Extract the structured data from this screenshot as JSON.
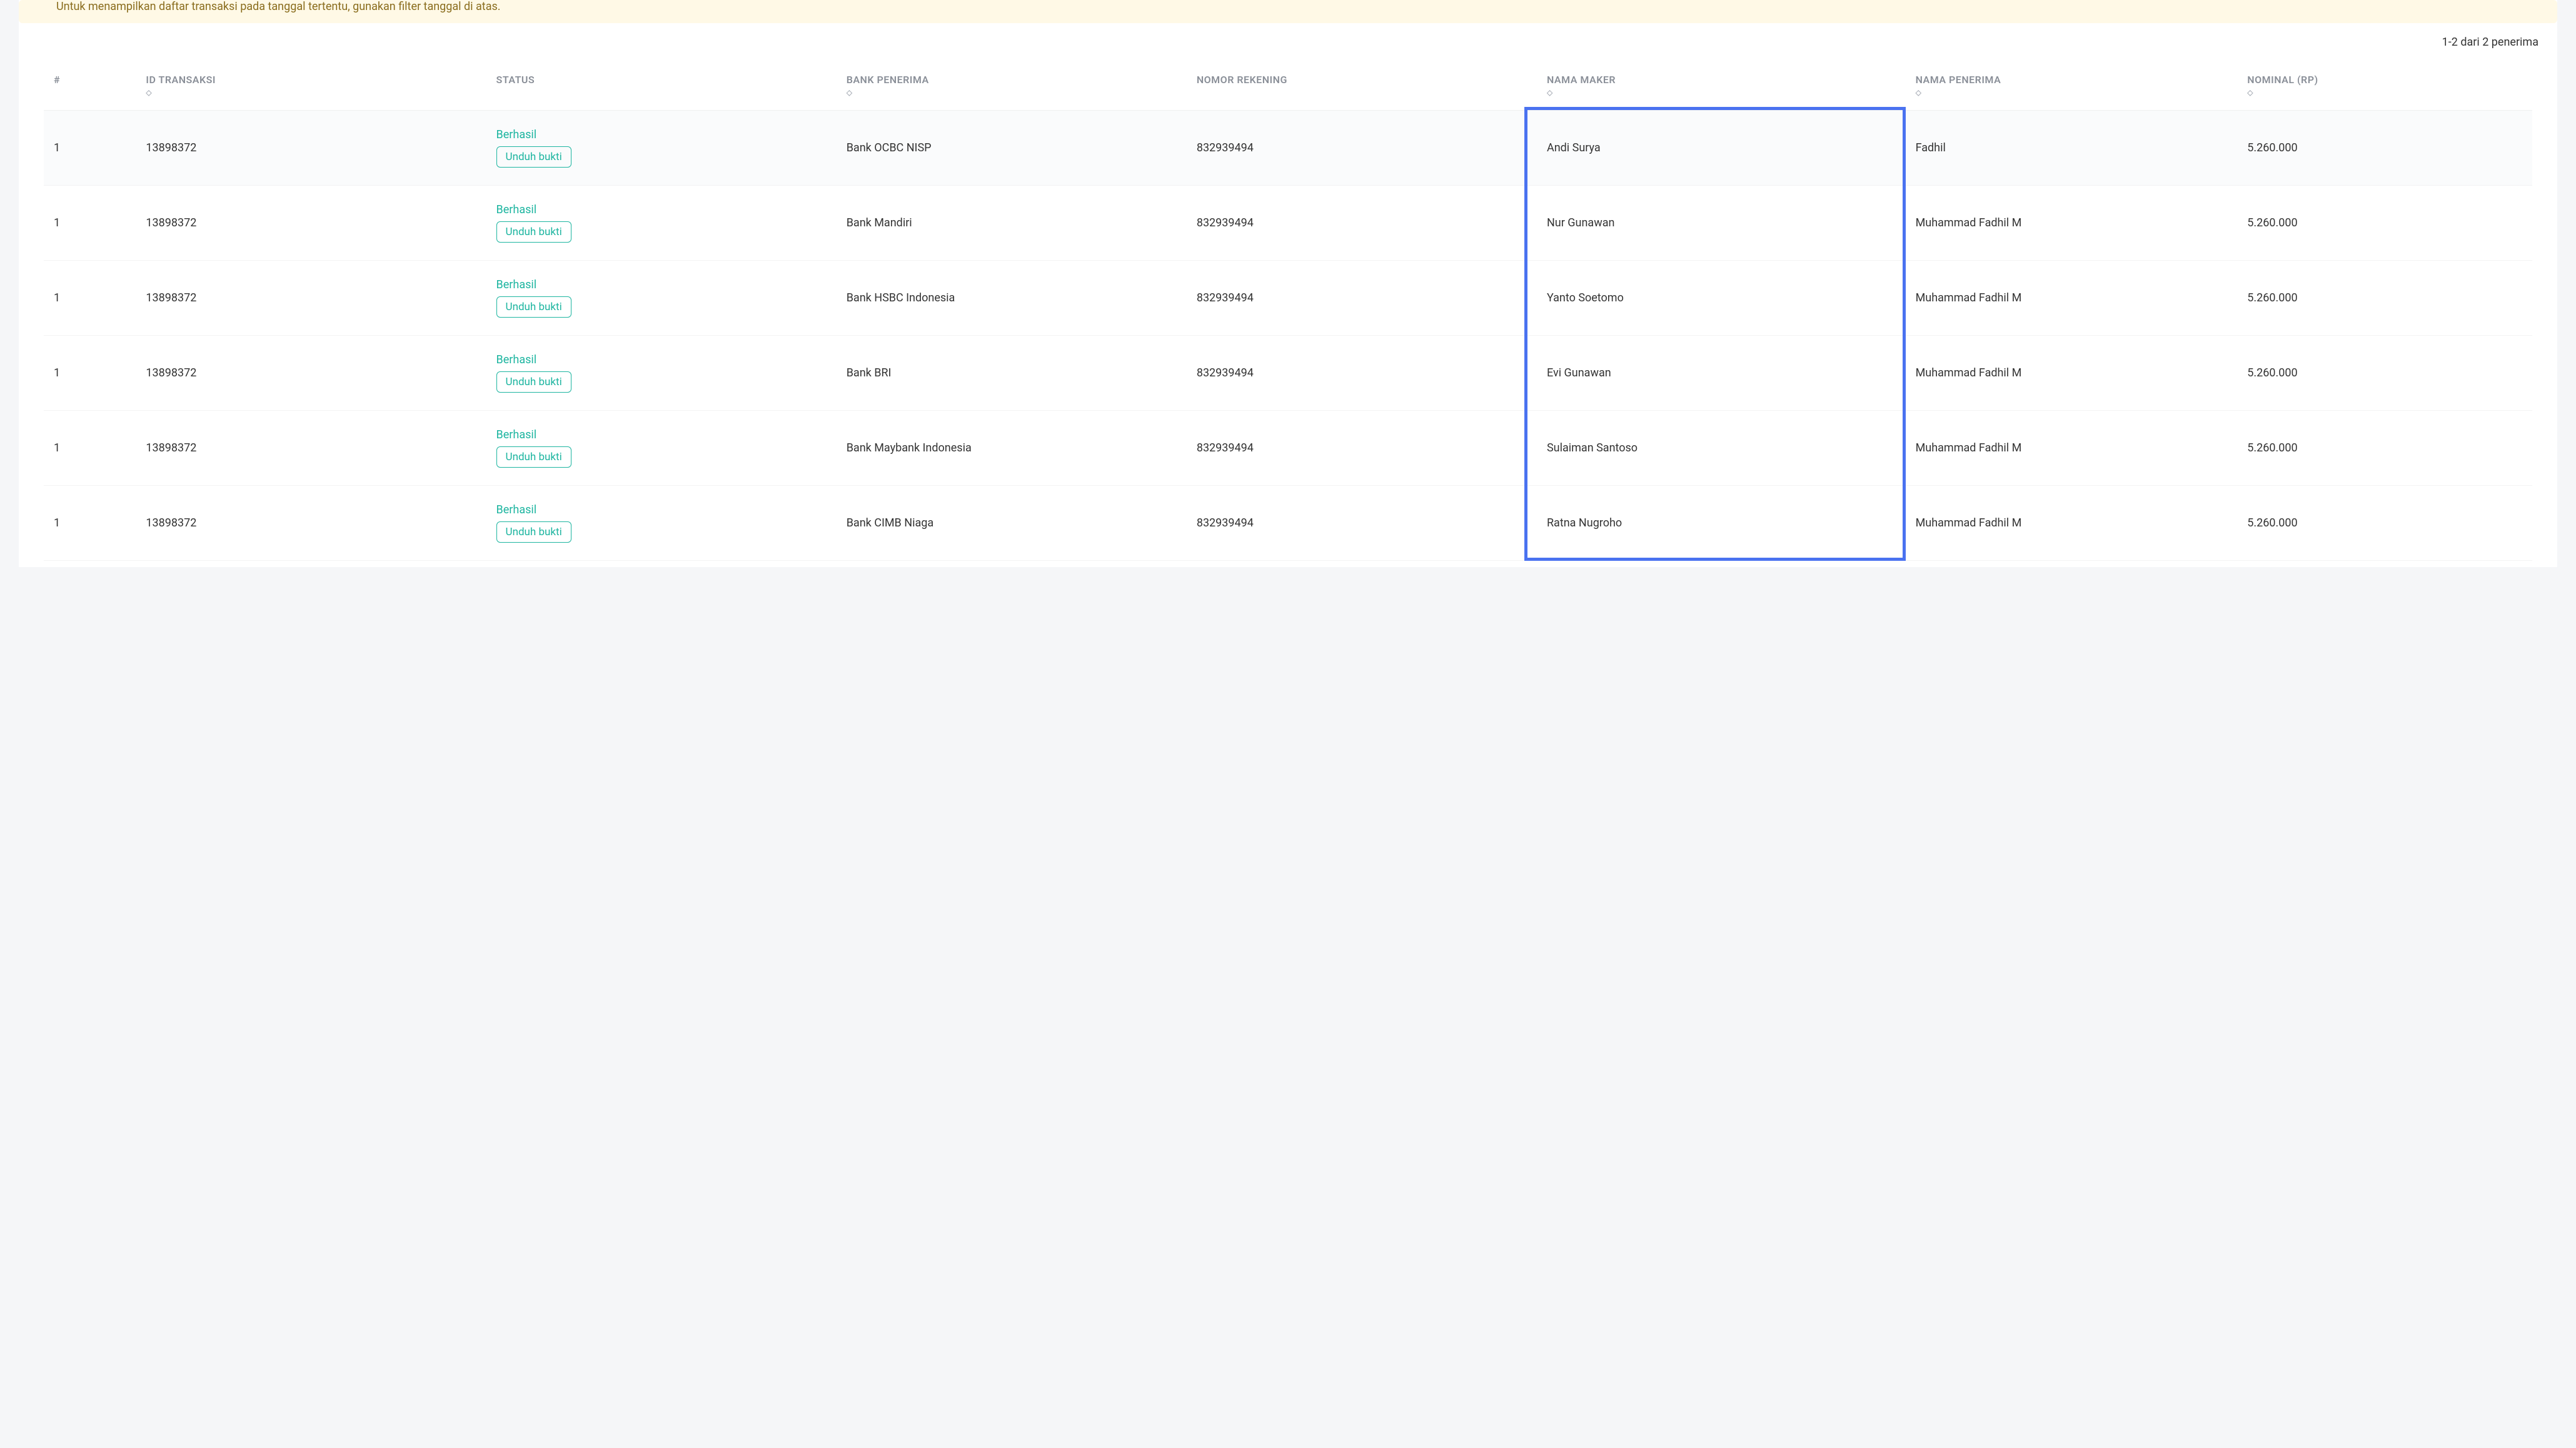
{
  "banner": {
    "text": "Untuk menampilkan daftar transaksi pada tanggal tertentu, gunakan filter tanggal di atas."
  },
  "pagination": {
    "text": "1-2 dari 2 penerima"
  },
  "table": {
    "headers": {
      "num": "#",
      "id": "ID TRANSAKSI",
      "status": "STATUS",
      "bank": "BANK PENERIMA",
      "rek": "NOMOR REKENING",
      "maker": "NAMA MAKER",
      "penerima": "NAMA PENERIMA",
      "nominal": "NOMINAL (RP)"
    },
    "sort_glyph": "◇",
    "status_label": "Berhasil",
    "download_label": "Unduh bukti",
    "rows": [
      {
        "num": "1",
        "id": "13898372",
        "bank": "Bank OCBC NISP",
        "rek": "832939494",
        "maker": "Andi Surya",
        "penerima": "Fadhil",
        "nominal": "5.260.000"
      },
      {
        "num": "1",
        "id": "13898372",
        "bank": "Bank Mandiri",
        "rek": "832939494",
        "maker": "Nur Gunawan",
        "penerima": "Muhammad Fadhil M",
        "nominal": "5.260.000"
      },
      {
        "num": "1",
        "id": "13898372",
        "bank": "Bank HSBC Indonesia",
        "rek": "832939494",
        "maker": "Yanto Soetomo",
        "penerima": "Muhammad Fadhil M",
        "nominal": "5.260.000"
      },
      {
        "num": "1",
        "id": "13898372",
        "bank": "Bank BRI",
        "rek": "832939494",
        "maker": "Evi Gunawan",
        "penerima": "Muhammad Fadhil M",
        "nominal": "5.260.000"
      },
      {
        "num": "1",
        "id": "13898372",
        "bank": "Bank Maybank Indonesia",
        "rek": "832939494",
        "maker": "Sulaiman Santoso",
        "penerima": "Muhammad Fadhil M",
        "nominal": "5.260.000"
      },
      {
        "num": "1",
        "id": "13898372",
        "bank": "Bank CIMB Niaga",
        "rek": "832939494",
        "maker": "Ratna Nugroho",
        "penerima": "Muhammad Fadhil M",
        "nominal": "5.260.000"
      }
    ]
  }
}
